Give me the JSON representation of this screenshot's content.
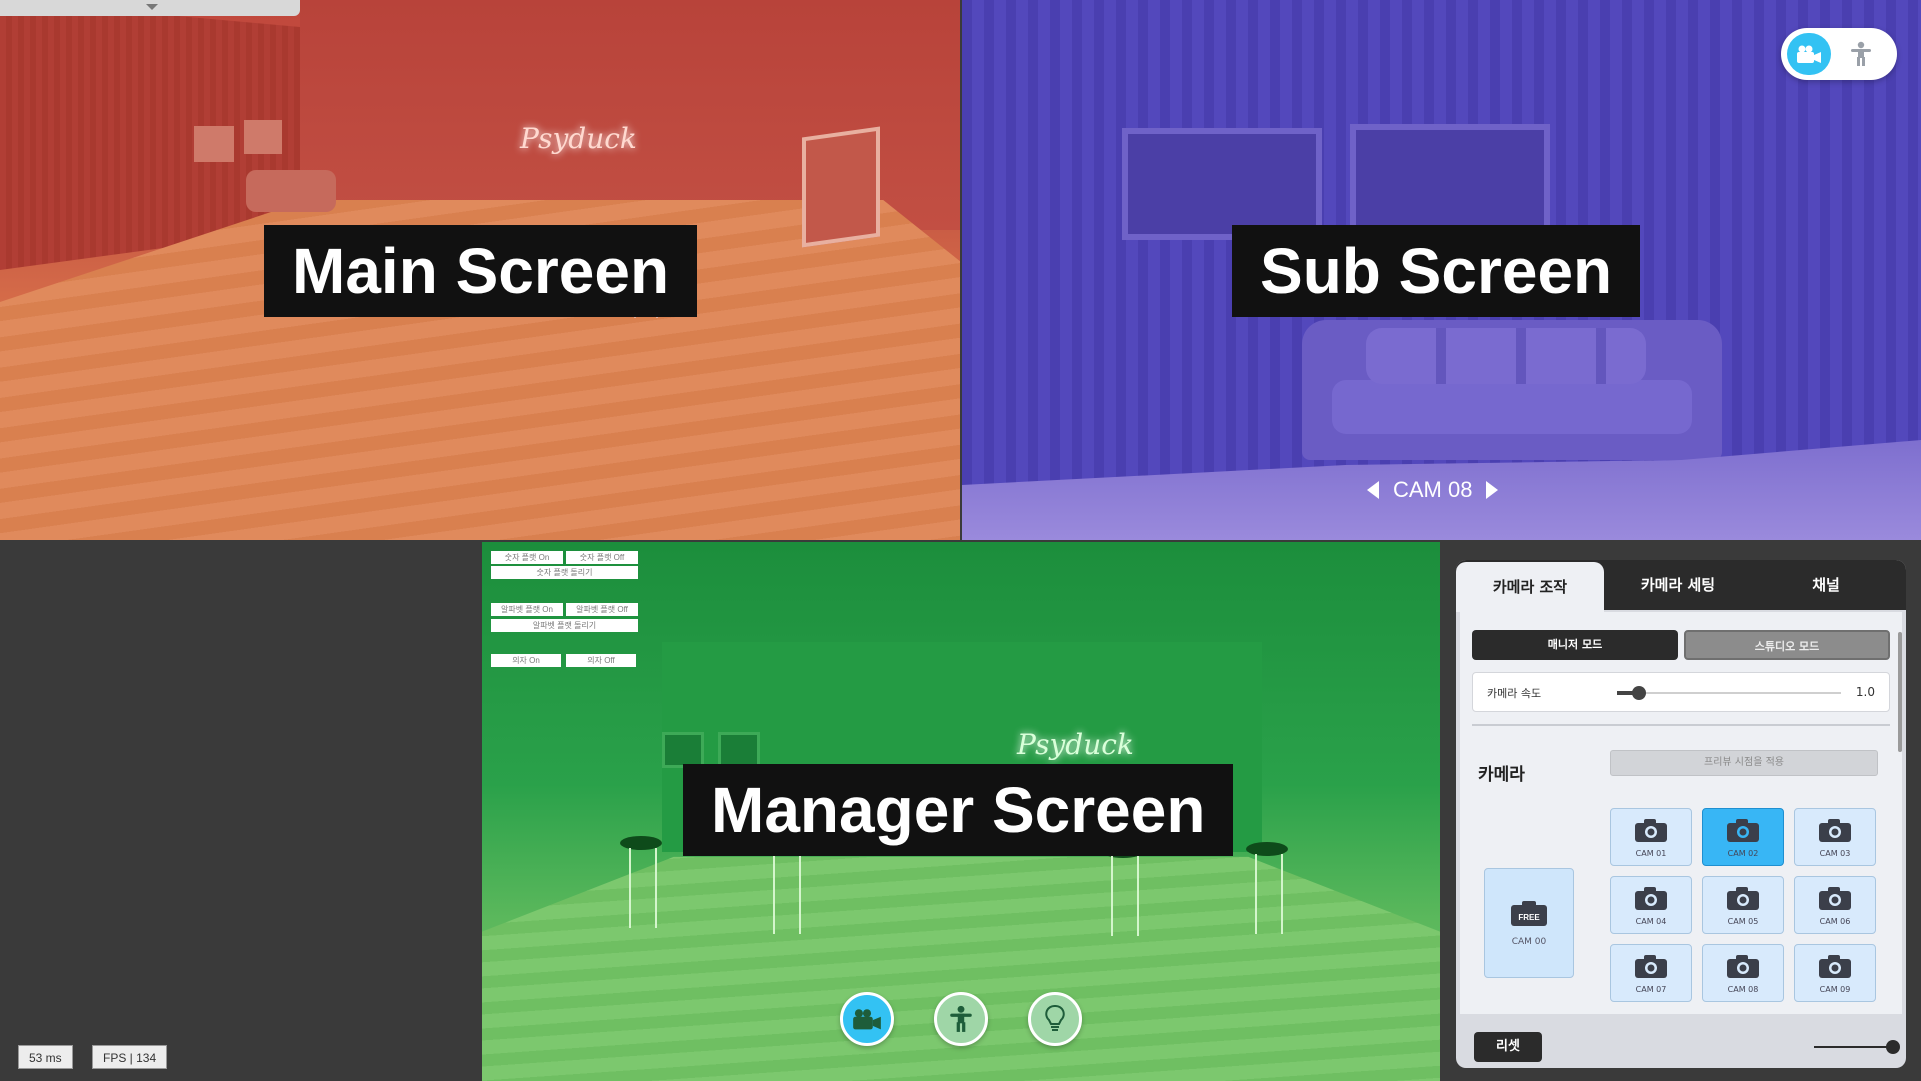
{
  "labels": {
    "main": "Main Screen",
    "sub": "Sub Screen",
    "manager": "Manager Screen"
  },
  "main_screen": {
    "neon_sign": "Psyduck"
  },
  "sub_screen": {
    "camera_label": "CAM 08",
    "toggle": [
      "camera-icon",
      "person-icon"
    ]
  },
  "stats": {
    "latency": "53 ms",
    "fps": "FPS | 134"
  },
  "manager_screen": {
    "neon_sign": "Psyduck",
    "debug_buttons": {
      "num_prop_on": "숫자 플랫 On",
      "num_prop_off": "숫자 플랫 Off",
      "num_prop_rotate": "숫자 플랫 돌리기",
      "alpha_prop_on": "알파벳 플랫 On",
      "alpha_prop_off": "알파벳 플랫 Off",
      "alpha_prop_rotate": "알파벳 플랫 돌리기",
      "chair_on": "의자 On",
      "chair_off": "의자 Off"
    },
    "bottom_buttons": [
      "camera-icon",
      "person-icon",
      "lightbulb-icon"
    ]
  },
  "control_panel": {
    "tabs": [
      "카메라 조작",
      "카메라 세팅",
      "채널"
    ],
    "active_tab": 0,
    "mode_buttons": {
      "manager": "매니저 모드",
      "studio": "스튜디오 모드"
    },
    "speed": {
      "label": "카메라 속도",
      "value": "1.0",
      "fraction": 0.1
    },
    "section_title": "카메라",
    "apply_button": "프리뷰 시점을 적용",
    "free_cam": {
      "badge": "FREE",
      "label": "CAM 00"
    },
    "cams": [
      "CAM 01",
      "CAM 02",
      "CAM 03",
      "CAM 04",
      "CAM 05",
      "CAM 06",
      "CAM 07",
      "CAM 08",
      "CAM 09"
    ],
    "selected_cam": "CAM 02",
    "reset_button": "리셋"
  },
  "colors": {
    "accent": "#38b6f5",
    "toggle_active": "#33c2f3"
  }
}
